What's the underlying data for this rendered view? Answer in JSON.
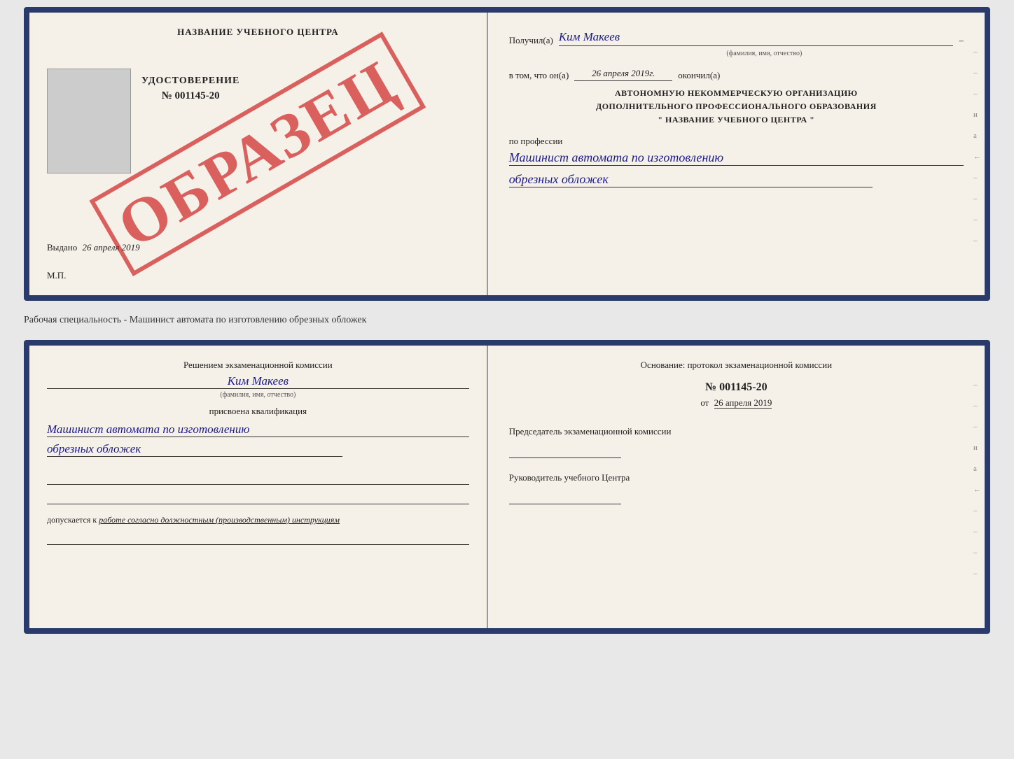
{
  "top_cert": {
    "left": {
      "training_center": "НАЗВАНИЕ УЧЕБНОГО ЦЕНТРА",
      "udostoverenie_label": "УДОСТОВЕРЕНИЕ",
      "number": "№ 001145-20",
      "vydano_label": "Выдано",
      "vydano_date": "26 апреля 2019",
      "mp_label": "М.П.",
      "watermark": "ОБРАЗЕЦ"
    },
    "right": {
      "poluchil_label": "Получил(а)",
      "poluchil_name": "Ким Макеев",
      "fio_caption": "(фамилия, имя, отчество)",
      "vtom_label": "в том, что он(а)",
      "date_value": "26 апреля 2019г.",
      "okoncil_label": "окончил(а)",
      "org_line1": "АВТОНОМНУЮ НЕКОММЕРЧЕСКУЮ ОРГАНИЗАЦИЮ",
      "org_line2": "ДОПОЛНИТЕЛЬНОГО ПРОФЕССИОНАЛЬНОГО ОБРАЗОВАНИЯ",
      "org_line3": "\"  НАЗВАНИЕ УЧЕБНОГО ЦЕНТРА  \"",
      "po_professii": "по профессии",
      "professiya1": "Машинист автомата по изготовлению",
      "professiya2": "обрезных обложек"
    }
  },
  "middle": {
    "text": "Рабочая специальность - Машинист автомата по изготовлению обрезных обложек"
  },
  "bottom_cert": {
    "left": {
      "resheniem_label": "Решением экзаменационной комиссии",
      "name": "Ким Макеев",
      "fio_caption": "(фамилия, имя, отчество)",
      "prisvoena_label": "присвоена квалификация",
      "kvalif1": "Машинист автомата по изготовлению",
      "kvalif2": "обрезных обложек",
      "dopusk_label": "допускается к",
      "dopusk_text": "работе согласно должностным (производственным) инструкциям"
    },
    "right": {
      "osnovanie_label": "Основание: протокол экзаменационной комиссии",
      "protocol_number": "№ 001145-20",
      "protocol_date_prefix": "от",
      "protocol_date": "26 апреля 2019",
      "predsedatel_label": "Председатель экзаменационной комиссии",
      "rukovoditel_label": "Руководитель учебного Центра"
    }
  },
  "side_dashes": [
    "–",
    "–",
    "–",
    "и",
    "а",
    "←",
    "–",
    "–",
    "–",
    "–"
  ],
  "side_dashes2": [
    "–",
    "–",
    "–",
    "и",
    "а",
    "←",
    "–",
    "–",
    "–",
    "–"
  ]
}
